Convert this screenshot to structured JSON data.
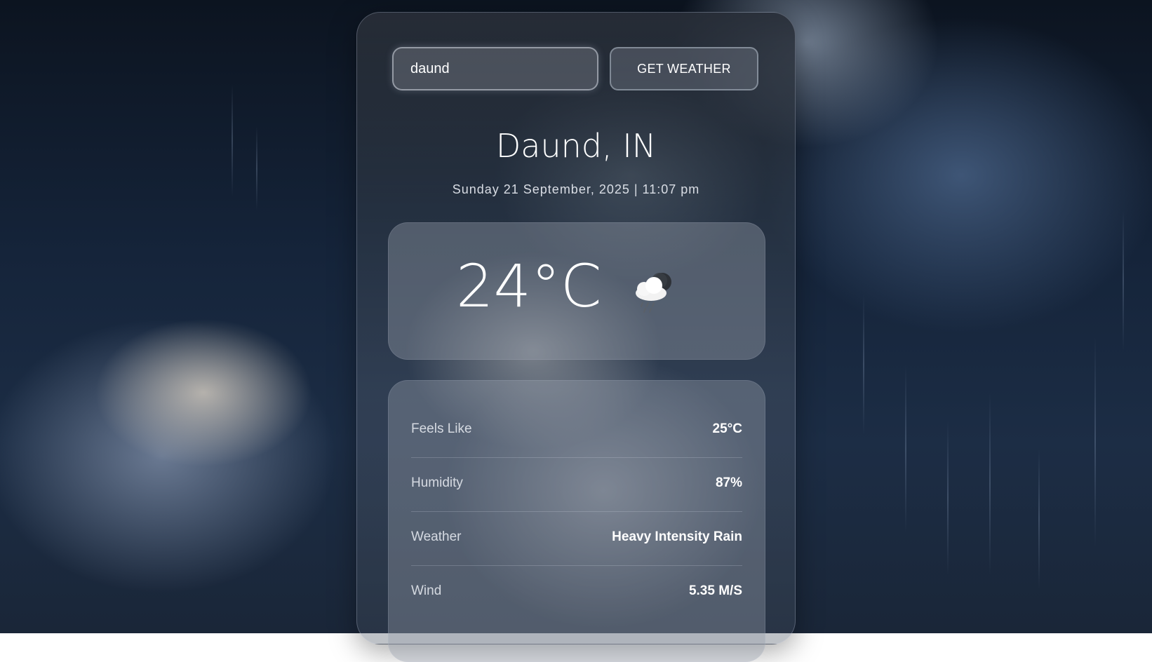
{
  "search": {
    "value": "daund",
    "button_label": "GET WEATHER"
  },
  "location": {
    "city": "Daund, IN",
    "datetime": "Sunday 21 September, 2025 | 11:07 pm"
  },
  "current": {
    "temperature": "24°C",
    "icon": "cloud-rain-night-icon"
  },
  "details": [
    {
      "label": "Feels Like",
      "value": "25°C"
    },
    {
      "label": "Humidity",
      "value": "87%"
    },
    {
      "label": "Weather",
      "value": "Heavy Intensity Rain"
    },
    {
      "label": "Wind",
      "value": "5.35 M/S"
    }
  ]
}
